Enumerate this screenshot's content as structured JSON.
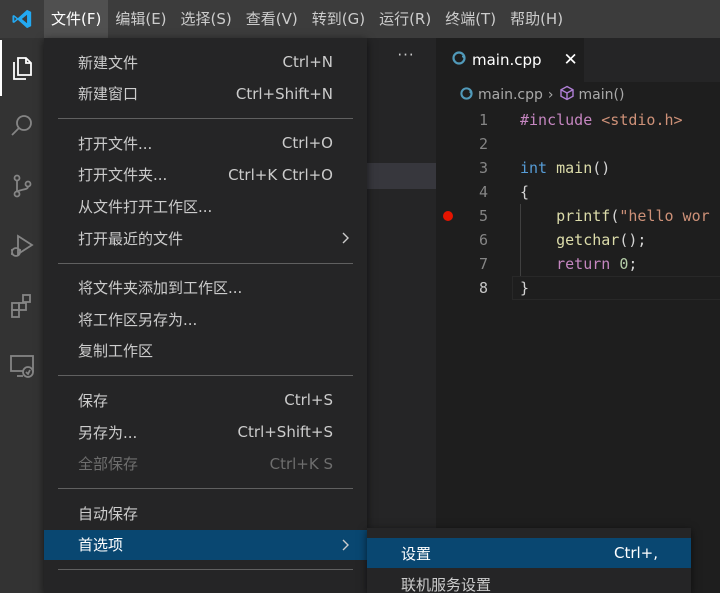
{
  "menubar": {
    "items": [
      "文件(F)",
      "编辑(E)",
      "选择(S)",
      "查看(V)",
      "转到(G)",
      "运行(R)",
      "终端(T)",
      "帮助(H)"
    ],
    "active_index": 0
  },
  "activity_bar": {
    "icons": [
      "explorer-icon",
      "search-icon",
      "source-control-icon",
      "run-debug-icon",
      "extensions-icon",
      "remote-explorer-icon"
    ],
    "active_icon": "explorer-icon"
  },
  "sidebar": {
    "more_label": "···"
  },
  "file_menu": {
    "groups": [
      [
        {
          "label": "新建文件",
          "shortcut": "Ctrl+N"
        },
        {
          "label": "新建窗口",
          "shortcut": "Ctrl+Shift+N"
        }
      ],
      [
        {
          "label": "打开文件...",
          "shortcut": "Ctrl+O"
        },
        {
          "label": "打开文件夹...",
          "shortcut": "Ctrl+K Ctrl+O"
        },
        {
          "label": "从文件打开工作区...",
          "shortcut": ""
        },
        {
          "label": "打开最近的文件",
          "shortcut": "",
          "submenu": true
        }
      ],
      [
        {
          "label": "将文件夹添加到工作区...",
          "shortcut": ""
        },
        {
          "label": "将工作区另存为...",
          "shortcut": ""
        },
        {
          "label": "复制工作区",
          "shortcut": ""
        }
      ],
      [
        {
          "label": "保存",
          "shortcut": "Ctrl+S"
        },
        {
          "label": "另存为...",
          "shortcut": "Ctrl+Shift+S"
        },
        {
          "label": "全部保存",
          "shortcut": "Ctrl+K S",
          "disabled": true
        }
      ],
      [
        {
          "label": "自动保存",
          "shortcut": ""
        },
        {
          "label": "首选项",
          "shortcut": "",
          "submenu": true,
          "selected": true
        }
      ]
    ]
  },
  "submenu": {
    "items": [
      {
        "label": "设置",
        "shortcut": "Ctrl+,",
        "selected": true
      },
      {
        "label": "联机服务设置",
        "shortcut": ""
      }
    ]
  },
  "editor": {
    "tab": {
      "label": "main.cpp",
      "close": "✕"
    },
    "breadcrumb": {
      "file": "main.cpp",
      "symbol": "main()"
    },
    "current_line": 8,
    "breakpoint_line": 5,
    "lines": [
      {
        "n": "1",
        "tokens": [
          [
            "inc",
            "#include "
          ],
          [
            "str",
            "<stdio.h>"
          ]
        ]
      },
      {
        "n": "2",
        "tokens": []
      },
      {
        "n": "3",
        "tokens": [
          [
            "kw",
            "int "
          ],
          [
            "fn",
            "main"
          ],
          [
            "def",
            "()"
          ]
        ]
      },
      {
        "n": "4",
        "tokens": [
          [
            "def",
            "{"
          ]
        ]
      },
      {
        "n": "5",
        "tokens": [
          [
            "def",
            "    "
          ],
          [
            "fn",
            "printf"
          ],
          [
            "def",
            "("
          ],
          [
            "str",
            "\"hello wor"
          ]
        ]
      },
      {
        "n": "6",
        "tokens": [
          [
            "def",
            "    "
          ],
          [
            "fn",
            "getchar"
          ],
          [
            "def",
            "();"
          ]
        ]
      },
      {
        "n": "7",
        "tokens": [
          [
            "def",
            "    "
          ],
          [
            "ctl",
            "return "
          ],
          [
            "num",
            "0"
          ],
          [
            "def",
            ";"
          ]
        ]
      },
      {
        "n": "8",
        "tokens": [
          [
            "def",
            "}"
          ]
        ]
      }
    ]
  },
  "colors": {
    "menubar_bg": "#3c3c3c",
    "menu_selection": "#094771",
    "breakpoint": "#e51400",
    "accent": "#007acc"
  }
}
